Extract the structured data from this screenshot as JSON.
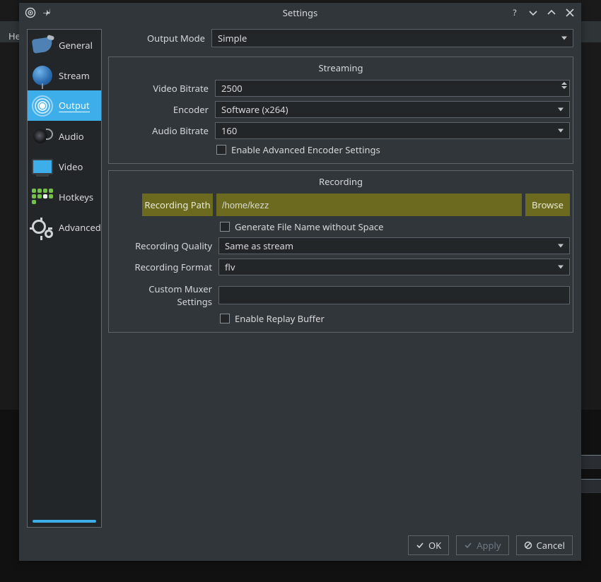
{
  "behind": {
    "menu_fragment": "He"
  },
  "window": {
    "title": "Settings"
  },
  "sidebar": {
    "items": [
      {
        "label": "General"
      },
      {
        "label": "Stream"
      },
      {
        "label": "Output"
      },
      {
        "label": "Audio"
      },
      {
        "label": "Video"
      },
      {
        "label": "Hotkeys"
      },
      {
        "label": "Advanced"
      }
    ],
    "active_index": 2
  },
  "output_mode": {
    "label": "Output Mode",
    "value": "Simple"
  },
  "streaming": {
    "title": "Streaming",
    "video_bitrate": {
      "label": "Video Bitrate",
      "value": "2500"
    },
    "encoder": {
      "label": "Encoder",
      "value": "Software (x264)"
    },
    "audio_bitrate": {
      "label": "Audio Bitrate",
      "value": "160"
    },
    "enable_advanced": {
      "label": "Enable Advanced Encoder Settings",
      "checked": false
    }
  },
  "recording": {
    "title": "Recording",
    "path": {
      "label": "Recording Path",
      "value": "/home/kezz",
      "browse": "Browse"
    },
    "no_space": {
      "label": "Generate File Name without Space",
      "checked": false
    },
    "quality": {
      "label": "Recording Quality",
      "value": "Same as stream"
    },
    "format": {
      "label": "Recording Format",
      "value": "flv"
    },
    "muxer": {
      "label": "Custom Muxer Settings",
      "value": ""
    },
    "replay_buffer": {
      "label": "Enable Replay Buffer",
      "checked": false
    }
  },
  "footer": {
    "ok": "OK",
    "apply": "Apply",
    "cancel": "Cancel"
  }
}
